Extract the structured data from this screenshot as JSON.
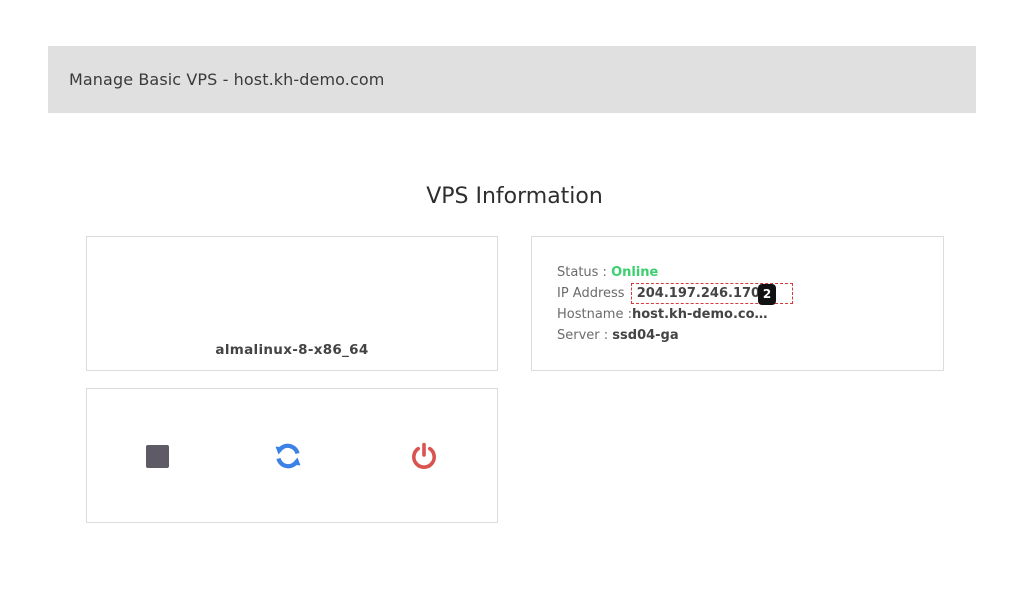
{
  "header": {
    "title": "Manage Basic VPS - host.kh-demo.com"
  },
  "section": {
    "title": "VPS Information"
  },
  "os_card": {
    "os_name": "almalinux-8-x86_64"
  },
  "info_card": {
    "status_label": "Status : ",
    "status_value": "Online",
    "ip_label": "IP Address",
    "ip_value": "204.197.246.170",
    "ip_badge": "2",
    "hostname_label": "Hostname :",
    "hostname_value": "host.kh-demo.co…",
    "server_label": "Server : ",
    "server_value": "ssd04-ga"
  },
  "actions": {
    "stop_icon": "stop-icon",
    "restart_icon": "refresh-icon",
    "power_icon": "power-icon"
  },
  "colors": {
    "status_online": "#3ccf6e",
    "stop": "#5e5a66",
    "restart": "#3b82e6",
    "power": "#d9534f",
    "highlight_border": "#d43c3c"
  }
}
